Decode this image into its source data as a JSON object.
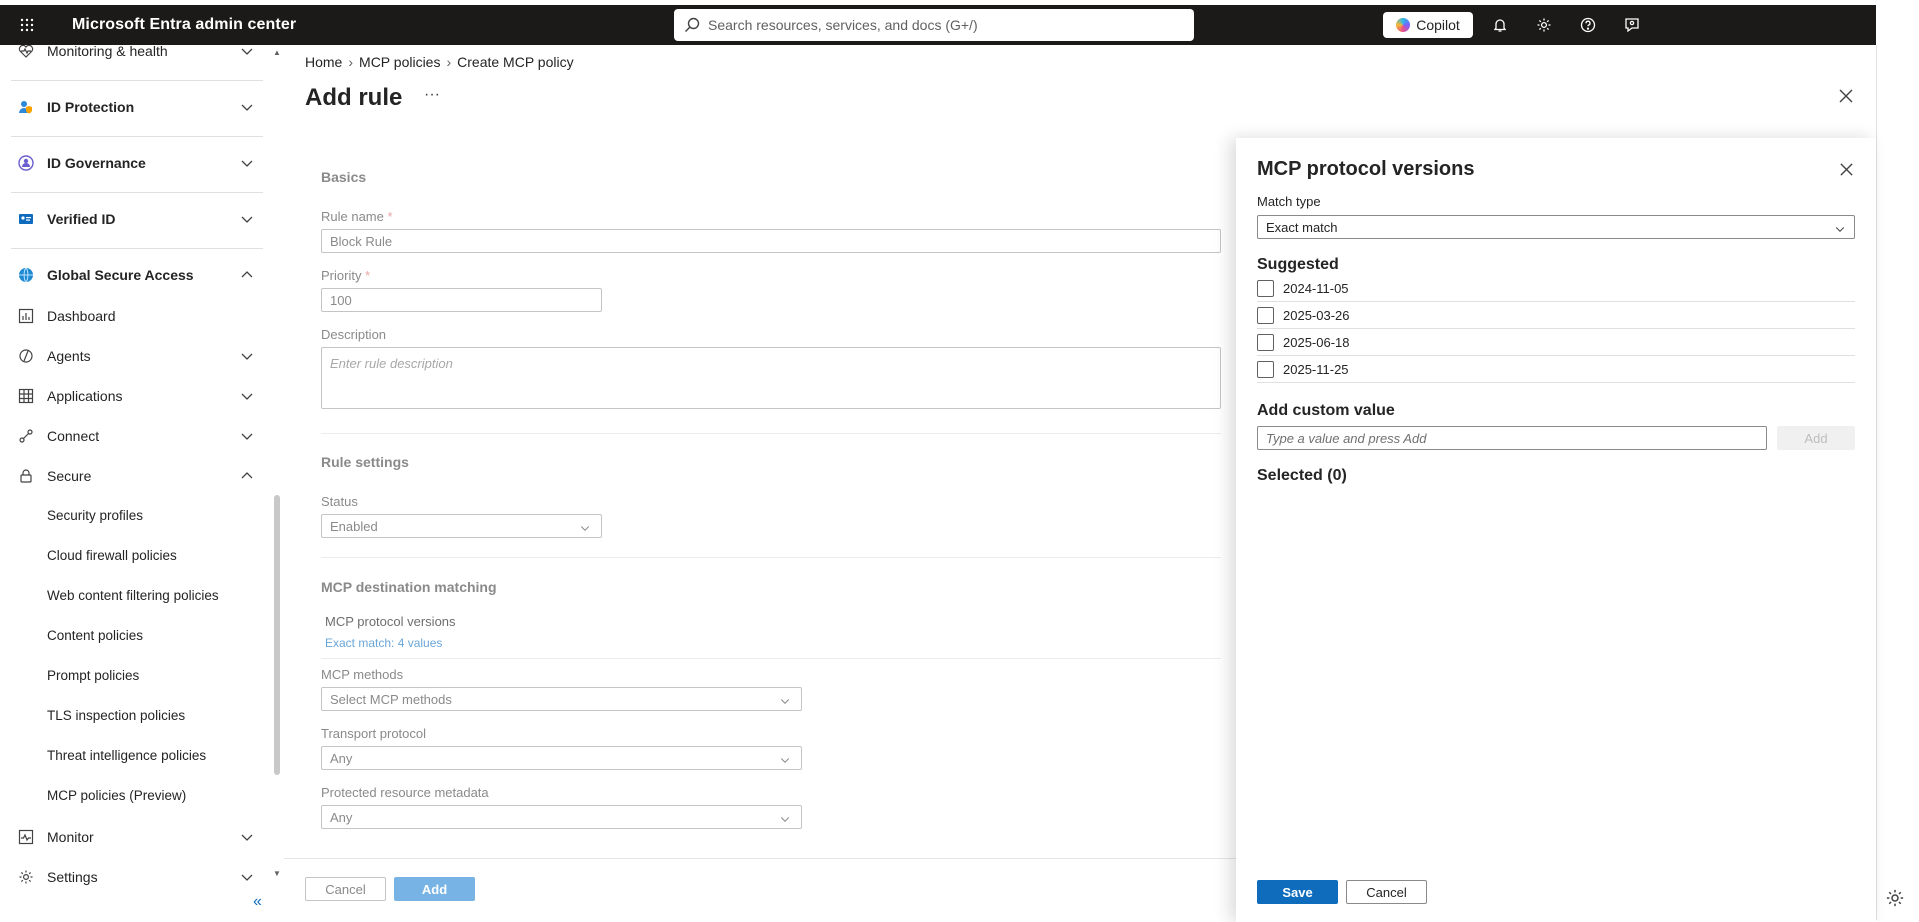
{
  "app": {
    "title": "Microsoft Entra admin center"
  },
  "search": {
    "placeholder": "Search resources, services, and docs (G+/)"
  },
  "topbar": {
    "copilot_label": "Copilot"
  },
  "sidebar": {
    "items": [
      {
        "label": "Monitoring & health",
        "icon": "heart-pulse-icon"
      },
      {
        "label": "ID Protection",
        "icon": "id-protection-icon"
      },
      {
        "label": "ID Governance",
        "icon": "id-governance-icon"
      },
      {
        "label": "Verified ID",
        "icon": "verified-id-icon"
      },
      {
        "label": "Global Secure Access",
        "icon": "globe-icon"
      },
      {
        "label": "Dashboard",
        "icon": "dashboard-icon"
      },
      {
        "label": "Agents",
        "icon": "agents-icon"
      },
      {
        "label": "Applications",
        "icon": "applications-icon"
      },
      {
        "label": "Connect",
        "icon": "connect-icon"
      },
      {
        "label": "Secure",
        "icon": "lock-icon"
      },
      {
        "label": "Monitor",
        "icon": "monitor-icon"
      },
      {
        "label": "Settings",
        "icon": "gear-icon"
      }
    ],
    "secure_sub": [
      "Security profiles",
      "Cloud firewall policies",
      "Web content filtering policies",
      "Content policies",
      "Prompt policies",
      "TLS inspection policies",
      "Threat intelligence policies",
      "MCP policies (Preview)"
    ]
  },
  "breadcrumb": [
    "Home",
    "MCP policies",
    "Create MCP policy"
  ],
  "page": {
    "title": "Add rule",
    "more": "···"
  },
  "form": {
    "basics": "Basics",
    "rule_name_label": "Rule name",
    "rule_name_value": "Block Rule",
    "priority_label": "Priority",
    "priority_value": "100",
    "required_mark": "*",
    "description_label": "Description",
    "description_placeholder": "Enter rule description",
    "rule_settings": "Rule settings",
    "status_label": "Status",
    "status_value": "Enabled",
    "mcp_matching": "MCP destination matching",
    "protocol_versions_label": "MCP protocol versions",
    "protocol_versions_summary": "Exact match: 4 values",
    "methods_label": "MCP methods",
    "methods_placeholder": "Select MCP methods",
    "transport_label": "Transport protocol",
    "transport_value": "Any",
    "metadata_label": "Protected resource metadata",
    "metadata_value": "Any",
    "cancel": "Cancel",
    "add": "Add"
  },
  "panel": {
    "title": "MCP protocol versions",
    "match_type_label": "Match type",
    "match_type_value": "Exact match",
    "suggested": "Suggested",
    "options": [
      "2024-11-05",
      "2025-03-26",
      "2025-06-18",
      "2025-11-25"
    ],
    "custom_heading": "Add custom value",
    "custom_placeholder": "Type a value and press Add",
    "add": "Add",
    "selected": "Selected (0)",
    "save": "Save",
    "cancel": "Cancel"
  },
  "colors": {
    "accent": "#0f6cbd",
    "topbar": "#1b1a19"
  }
}
